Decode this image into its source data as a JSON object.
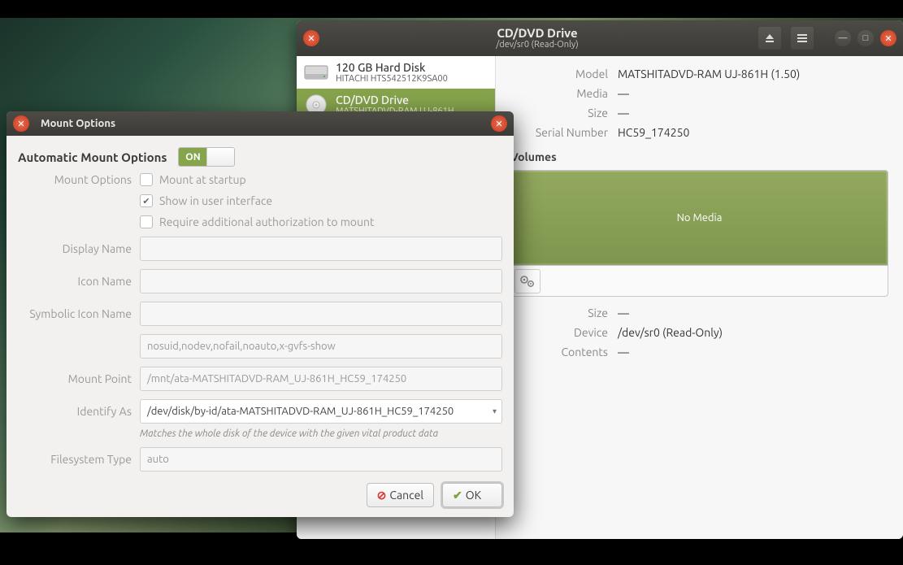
{
  "disks_window": {
    "title": "CD/DVD Drive",
    "subtitle": "/dev/sr0 (Read-Only)",
    "sidebar": [
      {
        "line1": "120 GB Hard Disk",
        "line2": "HITACHI HTS542512K9SA00",
        "selected": false,
        "icon": "hdd"
      },
      {
        "line1": "CD/DVD Drive",
        "line2": "MATSHITADVD-RAM UJ-861H",
        "selected": true,
        "icon": "optical"
      }
    ],
    "details": {
      "model_label": "Model",
      "model": "MATSHITADVD-RAM UJ-861H (1.50)",
      "media_label": "Media",
      "media": "—",
      "size_top_label": "Size",
      "size_top": "—",
      "serial_label": "Serial Number",
      "serial": "HC59_174250",
      "volumes_title": "Volumes",
      "volume_text": "No Media",
      "size_label": "Size",
      "size": "—",
      "device_label": "Device",
      "device": "/dev/sr0 (Read-Only)",
      "contents_label": "Contents",
      "contents": "—"
    }
  },
  "mount_dialog": {
    "title": "Mount Options",
    "auto_label": "Automatic Mount Options",
    "switch_state": "ON",
    "mount_options_label": "Mount Options",
    "cb_startup": "Mount at startup",
    "cb_show_ui": "Show in user interface",
    "cb_auth": "Require additional authorization to mount",
    "display_name_label": "Display Name",
    "display_name": "",
    "icon_name_label": "Icon Name",
    "icon_name": "",
    "sym_icon_label": "Symbolic Icon Name",
    "sym_icon": "",
    "options_value": "nosuid,nodev,nofail,noauto,x-gvfs-show",
    "mount_point_label": "Mount Point",
    "mount_point": "/mnt/ata-MATSHITADVD-RAM_UJ-861H_HC59_174250",
    "identify_label": "Identify As",
    "identify_value": "/dev/disk/by-id/ata-MATSHITADVD-RAM_UJ-861H_HC59_174250",
    "identify_hint": "Matches the whole disk of the device with the given vital product data",
    "fs_type_label": "Filesystem Type",
    "fs_type": "auto",
    "cancel": "Cancel",
    "ok": "OK"
  }
}
